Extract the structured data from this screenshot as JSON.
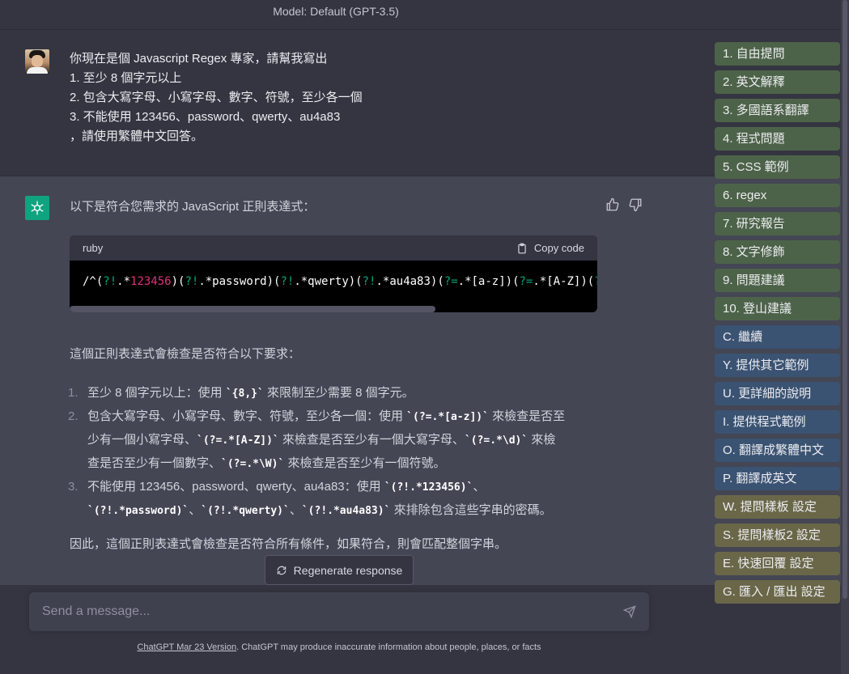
{
  "top": {
    "model_label": "Model: Default (GPT-3.5)"
  },
  "user_message": {
    "lines": [
      "你現在是個 Javascript Regex 專家，請幫我寫出",
      "1. 至少 8 個字元以上",
      "2. 包含大寫字母、小寫字母、數字、符號，至少各一個",
      "3. 不能使用 123456、password、qwerty、au4a83",
      "，請使用繁體中文回答。"
    ]
  },
  "assistant": {
    "intro": "以下是符合您需求的 JavaScript 正則表達式：",
    "code_lang": "ruby",
    "copy_label": "Copy code",
    "code_parts": [
      {
        "t": "/^(",
        "c": ""
      },
      {
        "t": "?!",
        "c": "green"
      },
      {
        "t": ".*",
        "c": ""
      },
      {
        "t": "123456",
        "c": "red"
      },
      {
        "t": ")(",
        "c": ""
      },
      {
        "t": "?!",
        "c": "green"
      },
      {
        "t": ".*password)(",
        "c": ""
      },
      {
        "t": "?!",
        "c": "green"
      },
      {
        "t": ".*qwerty)(",
        "c": ""
      },
      {
        "t": "?!",
        "c": "green"
      },
      {
        "t": ".*au4a83)(",
        "c": ""
      },
      {
        "t": "?=",
        "c": "green"
      },
      {
        "t": ".*[a-z])(",
        "c": ""
      },
      {
        "t": "?=",
        "c": "green"
      },
      {
        "t": ".*[A-Z])(",
        "c": ""
      },
      {
        "t": "?",
        "c": "green"
      }
    ],
    "para1": "這個正則表達式會檢查是否符合以下要求：",
    "list": {
      "item1": {
        "num": "1.",
        "a": "至少 8 個字元以上：使用 ",
        "code1": "`{8,}`",
        "b": " 來限制至少需要 8 個字元。"
      },
      "item2": {
        "num": "2.",
        "l1a": "包含大寫字母、小寫字母、數字、符號，至少各一個：使用 ",
        "l1code": "`(?=.*[a-z])`",
        "l1b": " 來檢查是否至",
        "l2a": "少有一個小寫字母、",
        "l2code": "`(?=.*[A-Z])`",
        "l2b": " 來檢查是否至少有一個大寫字母、",
        "l2code2": "`(?=.*\\d)`",
        "l2c": " 來檢",
        "l3a": "查是否至少有一個數字、",
        "l3code": "`(?=.*\\W)`",
        "l3b": " 來檢查是否至少有一個符號。"
      },
      "item3": {
        "num": "3.",
        "l1a": "不能使用 123456、password、qwerty、au4a83：使用 ",
        "l1code": "`(?!.*123456)`",
        "l1b": "、",
        "l2code1": "`(?!.*password)`",
        "l2a": "、",
        "l2code2": "`(?!.*qwerty)`",
        "l2b": "、",
        "l2code3": "`(?!.*au4a83)`",
        "l2c": " 來排除包含這些字串的密碼。"
      }
    },
    "para2": "因此，這個正則表達式會檢查是否符合所有條件，如果符合，則會匹配整個字串。"
  },
  "regen_label": "Regenerate response",
  "input": {
    "placeholder": "Send a message..."
  },
  "footer": {
    "link": "ChatGPT Mar 23 Version",
    "text": ". ChatGPT may produce inaccurate information about people, places, or facts"
  },
  "sidebar_buttons": [
    {
      "label": "1. 自由提問",
      "color": "green"
    },
    {
      "label": "2. 英文解釋",
      "color": "green"
    },
    {
      "label": "3. 多國語系翻譯",
      "color": "green"
    },
    {
      "label": "4. 程式問題",
      "color": "green"
    },
    {
      "label": "5. CSS 範例",
      "color": "green"
    },
    {
      "label": "6. regex",
      "color": "green"
    },
    {
      "label": "7. 研究報告",
      "color": "green"
    },
    {
      "label": "8. 文字修飾",
      "color": "green"
    },
    {
      "label": "9. 問題建議",
      "color": "green"
    },
    {
      "label": "10. 登山建議",
      "color": "green"
    },
    {
      "label": "C. 繼續",
      "color": "blue"
    },
    {
      "label": "Y. 提供其它範例",
      "color": "blue"
    },
    {
      "label": "U. 更詳細的說明",
      "color": "blue"
    },
    {
      "label": "I. 提供程式範例",
      "color": "blue"
    },
    {
      "label": "O. 翻譯成繁體中文",
      "color": "blue"
    },
    {
      "label": "P. 翻譯成英文",
      "color": "blue"
    },
    {
      "label": "W. 提問樣板 設定",
      "color": "olive"
    },
    {
      "label": "S. 提問樣板2 設定",
      "color": "olive"
    },
    {
      "label": "E. 快速回覆 設定",
      "color": "olive"
    },
    {
      "label": "G. 匯入 / 匯出 設定",
      "color": "olive"
    }
  ]
}
